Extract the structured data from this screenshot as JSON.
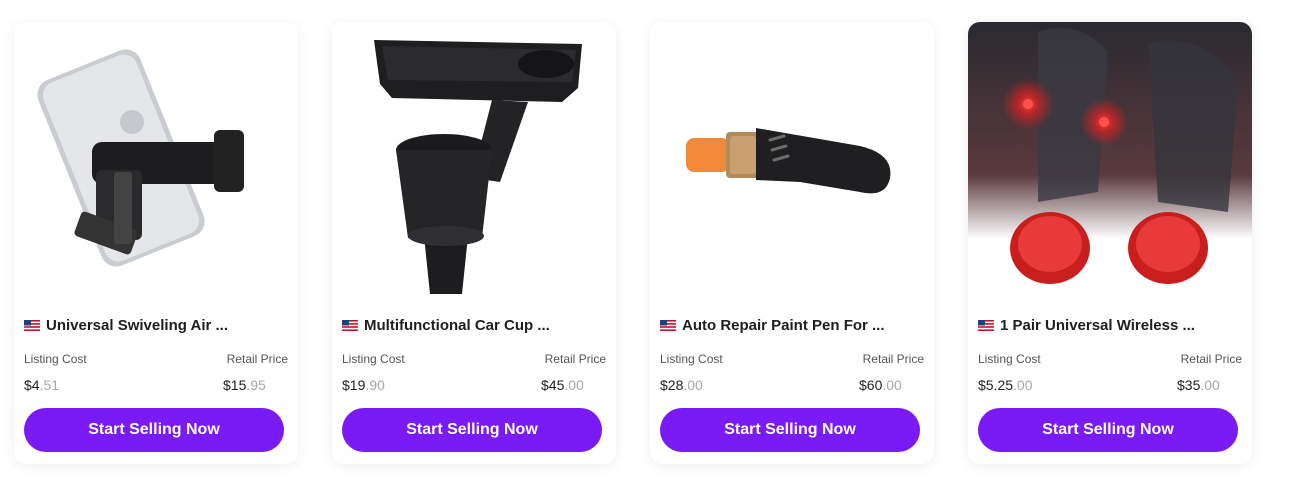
{
  "products": [
    {
      "image": "car-phone-holder",
      "flag": "us-flag-icon",
      "title": "Universal Swiveling Air ...",
      "listing_label": "Listing Cost",
      "listing_main": "$4",
      "listing_cents": ".51",
      "retail_label": "Retail Price",
      "retail_main": "$15",
      "retail_cents": ".95",
      "button": "Start Selling Now"
    },
    {
      "image": "car-cup-holder-tray",
      "flag": "us-flag-icon",
      "title": "Multifunctional Car Cup ...",
      "listing_label": "Listing Cost",
      "listing_main": "$19",
      "listing_cents": ".90",
      "retail_label": "Retail Price",
      "retail_main": "$45",
      "retail_cents": ".00",
      "button": "Start Selling Now"
    },
    {
      "image": "paint-pen",
      "flag": "us-flag-icon",
      "title": "Auto Repair Paint Pen For ...",
      "listing_label": "Listing Cost",
      "listing_main": "$28",
      "listing_cents": ".00",
      "retail_label": "Retail Price",
      "retail_main": "$60",
      "retail_cents": ".00",
      "button": "Start Selling Now"
    },
    {
      "image": "door-warning-lights",
      "flag": "us-flag-icon",
      "title": "1 Pair Universal Wireless ...",
      "listing_label": "Listing Cost",
      "listing_main": "$5.25",
      "listing_cents": ".00",
      "retail_label": "Retail Price",
      "retail_main": "$35",
      "retail_cents": ".00",
      "button": "Start Selling Now"
    }
  ],
  "colors": {
    "button": "#7a1af5",
    "cents": "#a7a7a7",
    "title": "#1f1f1f"
  }
}
